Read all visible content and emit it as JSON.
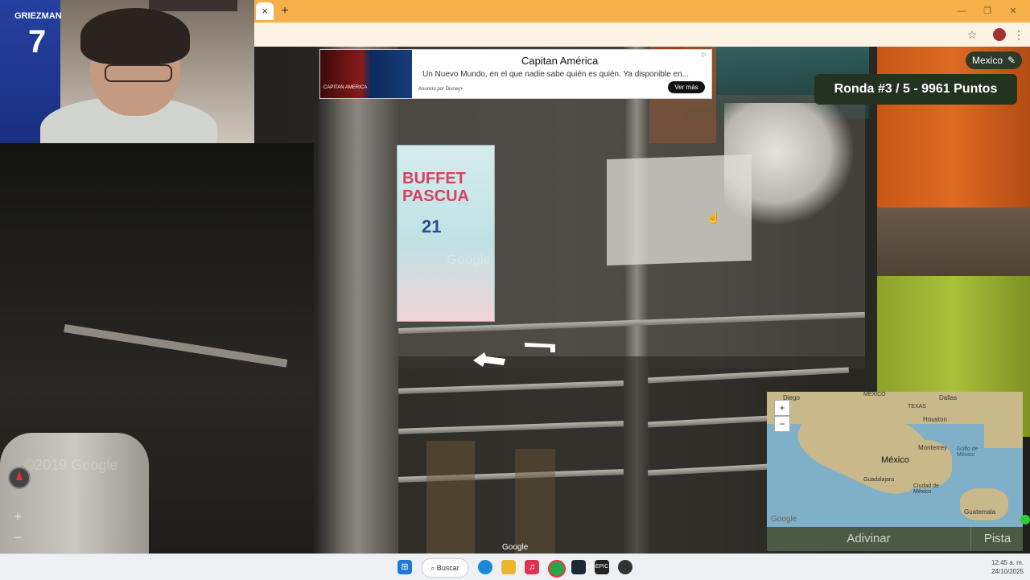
{
  "browser": {
    "tab_close": "×",
    "new_tab": "+",
    "window_controls": [
      "—",
      "❐",
      "✕"
    ],
    "star_icon": "☆",
    "menu_icon": "⋮"
  },
  "ad": {
    "title": "Capitan América",
    "body": "Un Nuevo Mundo, en el que nadie sabe quién es quién. Ya disponible en...",
    "source": "Anuncio por Disney+",
    "cta": "Ver más",
    "image_text": "CAPITAN AMERICA"
  },
  "hud": {
    "region": "Mexico",
    "round": "Ronda #3 / 5 - 9961 Puntos",
    "zoom_in": "+",
    "zoom_out": "−"
  },
  "scene": {
    "poster_line1": "BUFFET",
    "poster_line2": "PASCUA",
    "poster_number": "21",
    "google_watermark": "Google",
    "copyright_watermark": "©2019 Google",
    "google_logo": "Google"
  },
  "map": {
    "labels": {
      "diego": "Diego",
      "mexico_top": "MEXICO",
      "dallas": "Dallas",
      "texas": "TEXAS",
      "houston": "Houston",
      "monterrey": "Monterrey",
      "gulf": "Golfo de México",
      "mexico": "México",
      "guadalajara": "Guadalajara",
      "ciudad": "Ciudad de México",
      "guatemala": "Guatemala"
    },
    "zoom_in": "+",
    "zoom_out": "−",
    "google": "Google",
    "guess_button": "Adivinar",
    "hint_button": "Pista"
  },
  "webcam": {
    "jersey_name": "GRIEZMAN",
    "jersey_number": "7"
  },
  "taskbar": {
    "search": "Buscar",
    "time": "12:45 a. m.",
    "date": "24/10/2025"
  },
  "colors": {
    "tabbar": "#f7b04a",
    "hud_dark": "#24331f",
    "guess_bar": "#4a5a44"
  }
}
